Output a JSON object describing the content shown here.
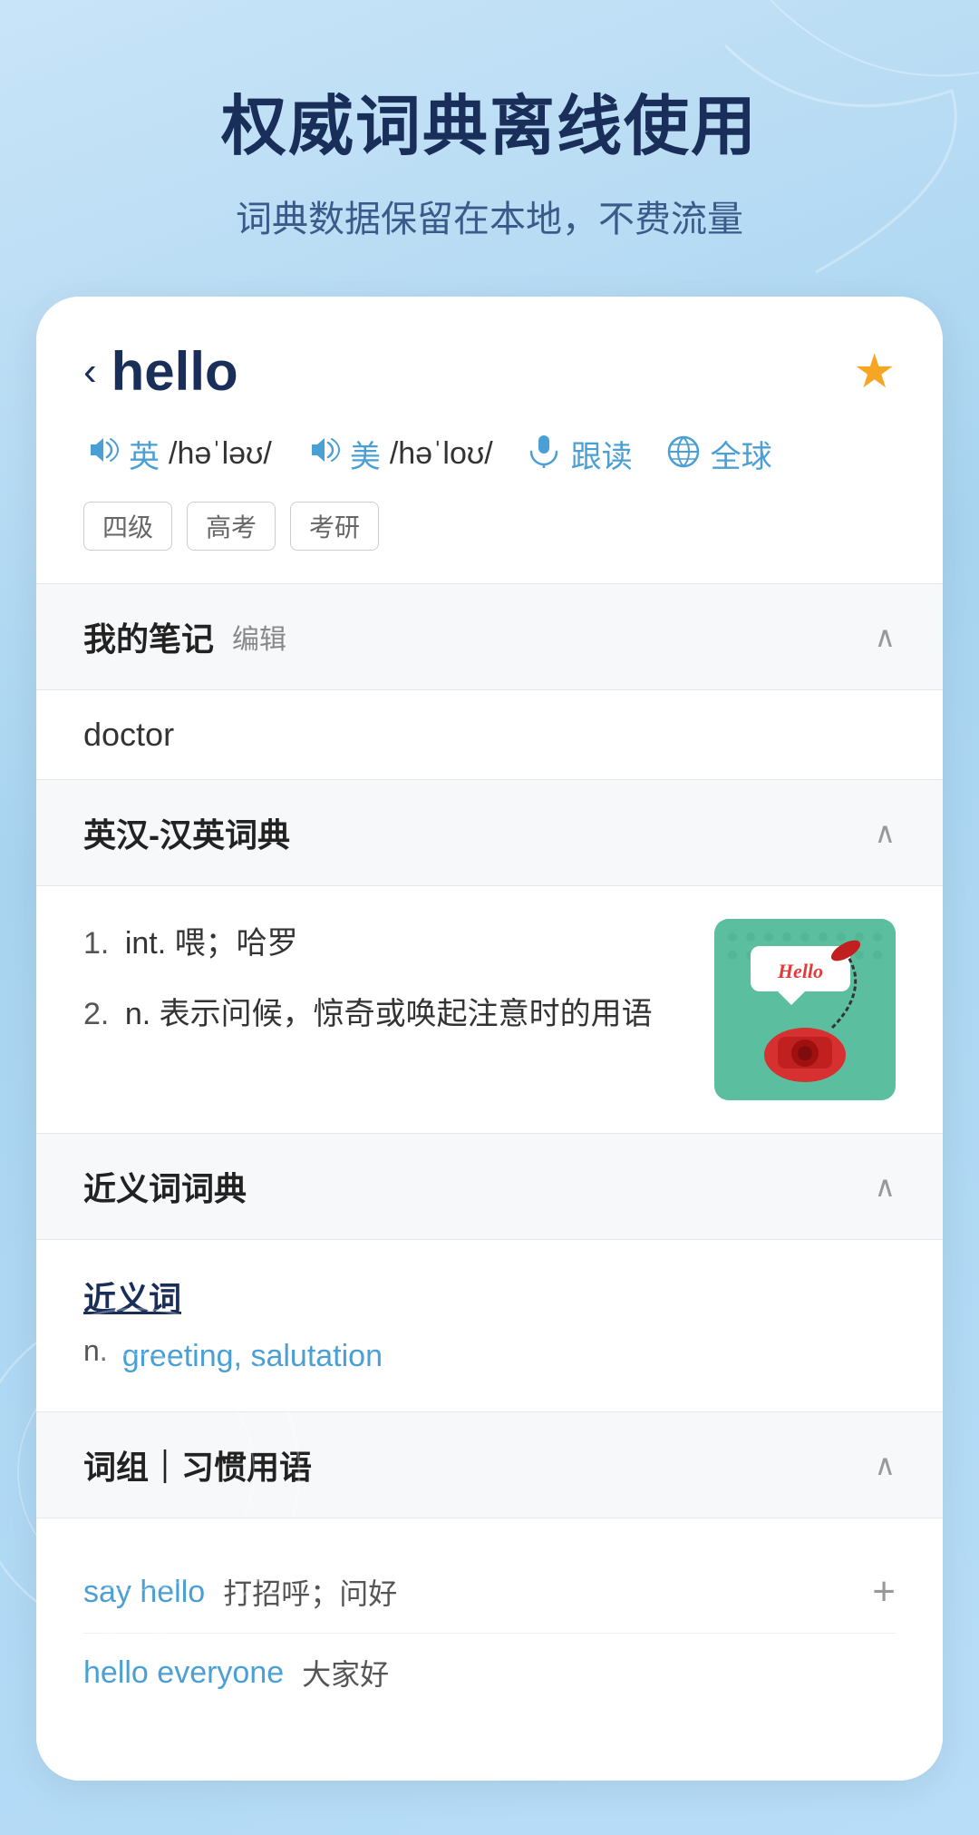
{
  "hero": {
    "title": "权威词典离线使用",
    "subtitle": "词典数据保留在本地，不费流量"
  },
  "word": {
    "back_label": "‹",
    "word": "hello",
    "star_label": "★",
    "pronunciations": [
      {
        "flag": "英",
        "phonetic": "/həˈləʊ/",
        "type": "british"
      },
      {
        "flag": "美",
        "phonetic": "/həˈloʊ/",
        "type": "american"
      },
      {
        "action": "跟读",
        "type": "follow"
      },
      {
        "action": "全球",
        "type": "global"
      }
    ],
    "tags": [
      "四级",
      "高考",
      "考研"
    ]
  },
  "sections": {
    "notes": {
      "title": "我的笔记",
      "edit_label": "编辑",
      "chevron": "∧",
      "content": "doctor"
    },
    "dictionary": {
      "title": "英汉-汉英词典",
      "chevron": "∧",
      "definitions": [
        {
          "num": "1.",
          "part": "int.",
          "text": "喂；哈罗"
        },
        {
          "num": "2.",
          "part": "n.",
          "text": "表示问候，惊奇或唤起注意时的用语"
        }
      ],
      "image_text": "Hello"
    },
    "synonyms": {
      "title": "近义词词典",
      "chevron": "∧",
      "label": "近义词",
      "part": "n.",
      "words": "greeting, salutation"
    },
    "phrases": {
      "title": "词组｜习惯用语",
      "chevron": "∧",
      "items": [
        {
          "phrase": "say hello",
          "meaning": "打招呼；问好",
          "has_add": true
        },
        {
          "phrase": "hello everyone",
          "meaning": "大家好",
          "has_add": false
        }
      ]
    }
  },
  "colors": {
    "blue": "#4a9fd4",
    "dark_blue": "#1a2e5a",
    "star_yellow": "#f5a623",
    "teal": "#5bbf9f"
  }
}
